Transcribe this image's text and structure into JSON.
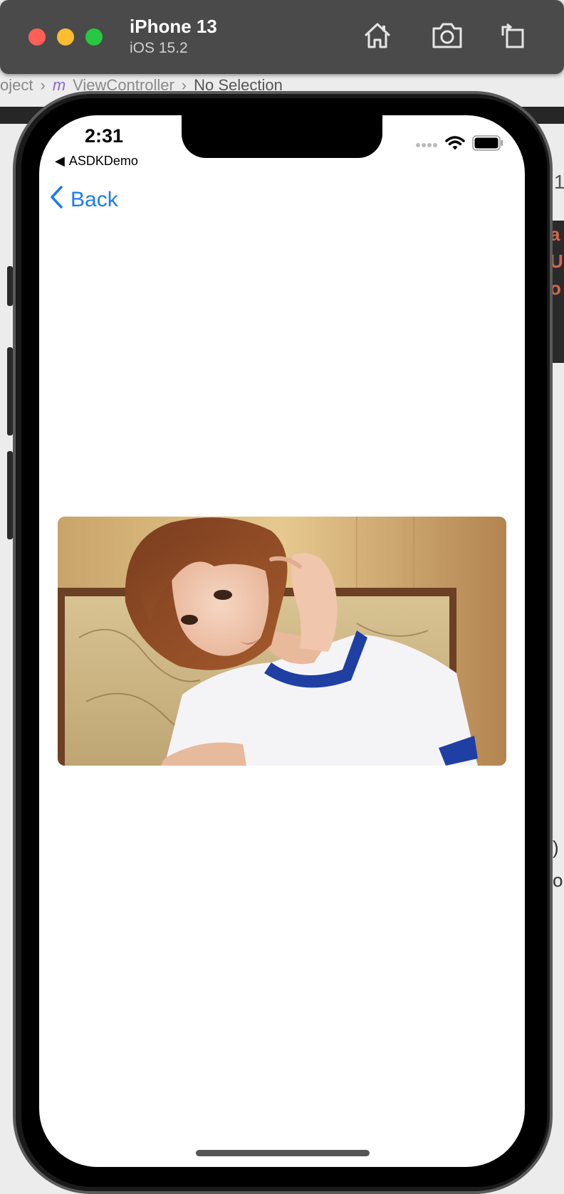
{
  "simulator": {
    "device_name": "iPhone 13",
    "os_version": "iOS 15.2",
    "toolbar_icons": [
      "home-icon",
      "screenshot-icon",
      "rotate-icon"
    ]
  },
  "xcode": {
    "breadcrumb": [
      "oject",
      "m",
      "ViewController",
      "No Selection"
    ],
    "right_code_chars": [
      "a",
      "U",
      "o"
    ],
    "right_text_1": ")",
    "right_text_2": "o",
    "right_small": ".1"
  },
  "status_bar": {
    "time": "2:31",
    "back_app": "ASDKDemo"
  },
  "nav": {
    "back_label": "Back"
  },
  "colors": {
    "accent": "#1a7cf0",
    "traffic_red": "#fe5f57",
    "traffic_yellow": "#febc2e",
    "traffic_green": "#28c840"
  }
}
